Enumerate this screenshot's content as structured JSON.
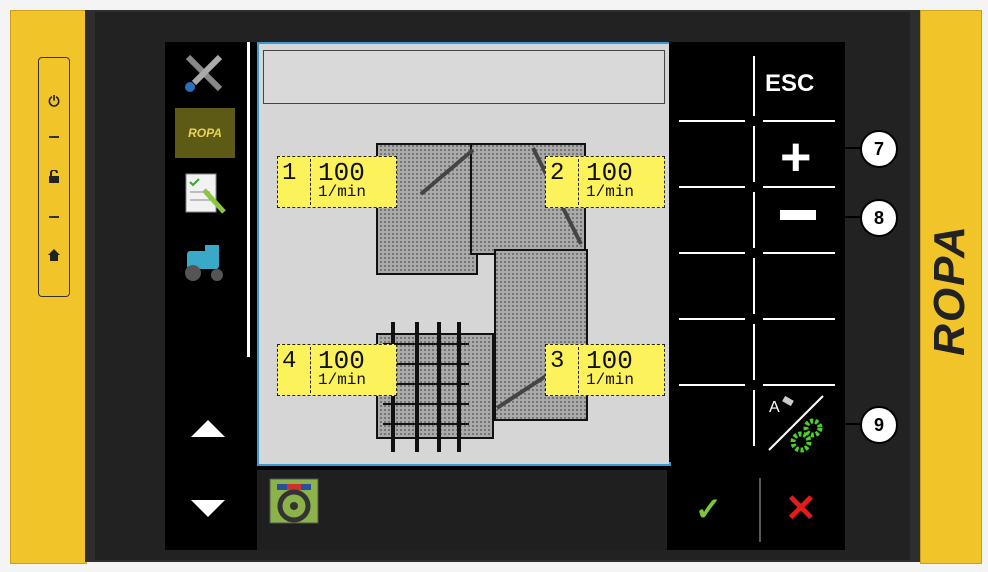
{
  "device": {
    "brand": "ROPA",
    "hardware_buttons": [
      {
        "name": "power",
        "glyph": "⏻"
      },
      {
        "name": "lock",
        "glyph": "🔓"
      },
      {
        "name": "home",
        "glyph": "⌂"
      }
    ]
  },
  "menu": {
    "items": [
      {
        "name": "tools-icon"
      },
      {
        "name": "ropa-logo",
        "label": "ROPA"
      },
      {
        "name": "checklist-icon"
      },
      {
        "name": "tractor-icon"
      }
    ],
    "scroll_up": "▲",
    "scroll_down": "▼"
  },
  "content": {
    "title": "",
    "sections": [
      {
        "id": "1",
        "value": "100",
        "unit": "1/min"
      },
      {
        "id": "2",
        "value": "100",
        "unit": "1/min"
      },
      {
        "id": "3",
        "value": "100",
        "unit": "1/min"
      },
      {
        "id": "4",
        "value": "100",
        "unit": "1/min"
      }
    ]
  },
  "softkeys": {
    "esc": "ESC",
    "plus": "+",
    "minus": "",
    "auto_label": "A"
  },
  "bottom": {
    "ok": "✓",
    "cancel": "✕"
  },
  "callouts": [
    "7",
    "8",
    "9"
  ],
  "colors": {
    "bezel": "#f1c52a",
    "accent_border": "#3a9bd3",
    "label_bg": "#fbf25c",
    "ok": "#7cc73b",
    "cancel": "#e31b1b",
    "gear": "#4cd12a"
  }
}
